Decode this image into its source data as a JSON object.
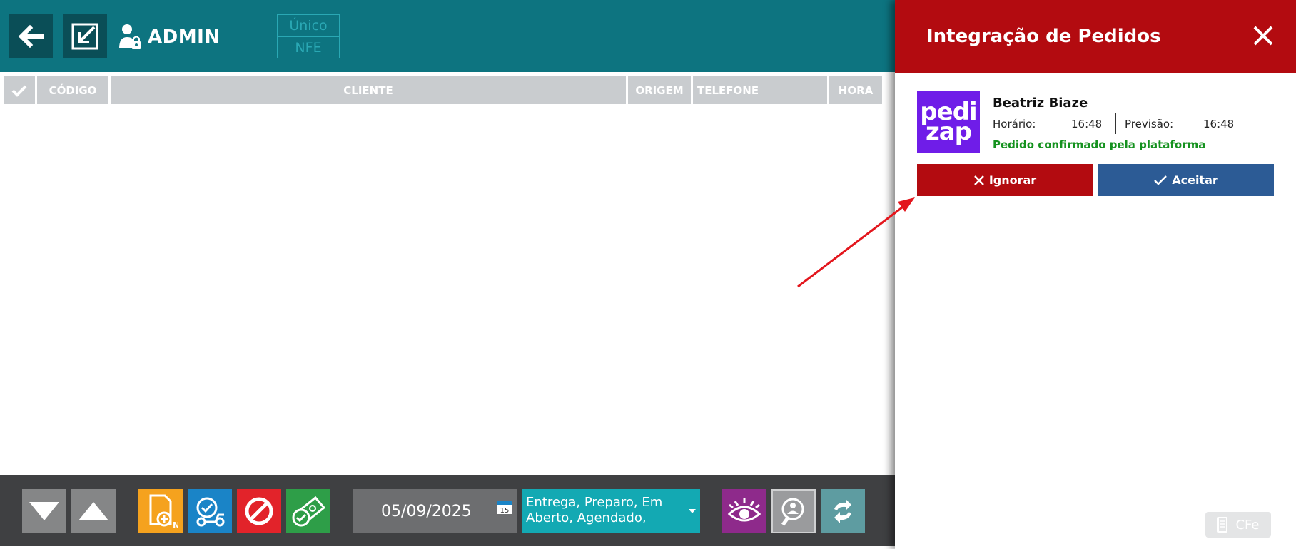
{
  "header": {
    "user_name": "ADMIN",
    "mode_top": "Único",
    "mode_bottom": "NFE"
  },
  "table": {
    "columns": [
      "CÓDIGO",
      "CLIENTE",
      "ORIGEM",
      "TELEFONE",
      "HORA"
    ]
  },
  "footer": {
    "date": "05/09/2025",
    "calendar_day": "15",
    "status_filter": "Entrega, Preparo, Em Aberto, Agendado,"
  },
  "panel": {
    "title": "Integração de Pedidos",
    "order": {
      "logo_line1": "pedi",
      "logo_line2": "zap",
      "customer": "Beatriz Biaze",
      "horario_label": "Horário:",
      "horario_value": "16:48",
      "previsao_label": "Previsão:",
      "previsao_value": "16:48",
      "status": "Pedido confirmado pela plataforma"
    },
    "ignore_label": "Ignorar",
    "accept_label": "Aceitar",
    "cfe_label": "CFe"
  },
  "colors": {
    "topbar": "#0d7480",
    "panel_header": "#b30b10",
    "accept": "#2c5b95",
    "confirmed_text": "#15921f",
    "logo_bg": "#6f1de8",
    "annotation_arrow": "#e3161d"
  },
  "icons": [
    "back-arrow-icon",
    "edit-icon",
    "user-lock-icon",
    "check-icon",
    "down-triangle-icon",
    "up-triangle-icon",
    "new-order-icon",
    "delivery-icon",
    "cancel-icon",
    "payment-icon",
    "calendar-icon",
    "eye-icon",
    "search-user-icon",
    "refresh-icon",
    "close-icon",
    "cfe-printer-icon"
  ]
}
